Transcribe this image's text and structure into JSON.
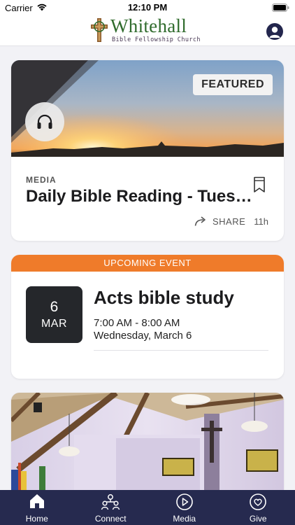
{
  "status_bar": {
    "carrier": "Carrier",
    "time": "12:10 PM"
  },
  "header": {
    "logo_title": "Whitehall",
    "logo_subtitle": "Bible Fellowship Church",
    "profile_icon": "person-icon"
  },
  "featured_card": {
    "badge": "FEATURED",
    "category": "MEDIA",
    "title": "Daily Bible Reading - Tuesday",
    "share_label": "SHARE",
    "age": "11h",
    "audio_icon": "headphones-icon",
    "bookmark_icon": "bookmark-icon",
    "share_icon": "share-arrow-icon"
  },
  "event_card": {
    "banner": "UPCOMING EVENT",
    "day": "6",
    "month": "MAR",
    "title": "Acts bible study",
    "time": "7:00 AM - 8:00 AM",
    "date": "Wednesday, March 6"
  },
  "tabs": [
    {
      "label": "Home",
      "icon": "home-icon"
    },
    {
      "label": "Connect",
      "icon": "people-icon"
    },
    {
      "label": "Media",
      "icon": "play-icon"
    },
    {
      "label": "Give",
      "icon": "heart-icon"
    }
  ],
  "colors": {
    "accent_orange": "#ef7b2a",
    "tab_bar": "#262a4f",
    "logo_green": "#2f6b2c"
  }
}
